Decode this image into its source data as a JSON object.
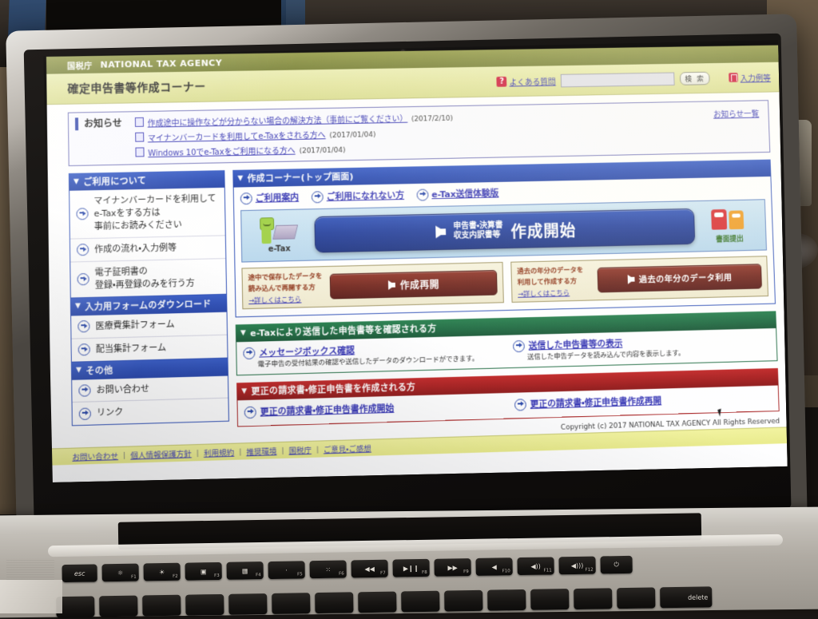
{
  "header": {
    "agency_jp": "国税庁",
    "agency_en": "NATIONAL TAX AGENCY",
    "site_title": "確定申告書等作成コーナー",
    "faq_badge": "?",
    "faq_label": "よくある質問",
    "search_value": "",
    "search_placeholder": "",
    "search_button": "検 索",
    "examples_label": "入力例等"
  },
  "notices": {
    "label": "お知らせ",
    "view_all": "お知らせ一覧",
    "items": [
      {
        "text": "作成途中に操作などが分からない場合の解決方法（事前にご覧ください）",
        "date": "(2017/2/10)"
      },
      {
        "text": "マイナンバーカードを利用してe-Taxをされる方へ",
        "date": "(2017/01/04)"
      },
      {
        "text": "Windows 10でe-Taxをご利用になる方へ",
        "date": "(2017/01/04)"
      }
    ]
  },
  "sidebar": {
    "sections": [
      {
        "title": "ご利用について",
        "items": [
          {
            "lines": [
              "マイナンバーカードを利用して",
              "e-Taxをする方は",
              "事前にお読みください"
            ]
          },
          {
            "lines": [
              "作成の流れ・入力例等"
            ]
          },
          {
            "lines": [
              "電子証明書の",
              "登録・再登録のみを行う方"
            ]
          }
        ]
      },
      {
        "title": "入力用フォームのダウンロード",
        "items": [
          {
            "lines": [
              "医療費集計フォーム"
            ]
          },
          {
            "lines": [
              "配当集計フォーム"
            ]
          }
        ]
      },
      {
        "title": "その他",
        "items": [
          {
            "lines": [
              "お問い合わせ"
            ]
          },
          {
            "lines": [
              "リンク"
            ]
          }
        ]
      }
    ]
  },
  "main": {
    "title": "作成コーナー(トップ画面)",
    "top_links": [
      "ご利用案内",
      "ご利用になれない方",
      "e-Tax送信体験版"
    ],
    "start_band": {
      "etax_label": "e-Tax",
      "button_sub_line1": "申告書・決算書",
      "button_sub_line2": "収支内訳書等",
      "button_main": "作成開始",
      "paper_label": "書面提出"
    },
    "resume_boxes": [
      {
        "desc_line1": "途中で保存したデータを",
        "desc_line2": "読み込んで再開する方",
        "more": "→詳しくはこちら",
        "button": "作成再開"
      },
      {
        "desc_line1": "過去の年分のデータを",
        "desc_line2": "利用して作成する方",
        "more": "→詳しくはこちら",
        "button": "過去の年分のデータ利用"
      }
    ]
  },
  "etax_section": {
    "title": "e-Taxにより送信した申告書等を確認される方",
    "links": [
      {
        "label": "メッセージボックス確認",
        "desc": "電子申告の受付結果の確認や送信したデータのダウンロードができます。"
      },
      {
        "label": "送信した申告書等の表示",
        "desc": "送信した申告データを読み込んで内容を表示します。"
      }
    ]
  },
  "amend_section": {
    "title": "更正の請求書・修正申告書を作成される方",
    "links": [
      {
        "label": "更正の請求書・修正申告書作成開始",
        "desc": ""
      },
      {
        "label": "更正の請求書・修正申告書作成再開",
        "desc": ""
      }
    ]
  },
  "footer": {
    "copyright": "Copyright (c) 2017 NATIONAL TAX AGENCY All Rights Reserved",
    "links": [
      "お問い合わせ",
      "個人情報保護方針",
      "利用規約",
      "推奨環境",
      "国税庁",
      "ご意見・ご感想"
    ],
    "separator": "|"
  },
  "hardware": {
    "keys_fn": [
      "esc",
      "F1",
      "F2",
      "F3",
      "F4",
      "F5",
      "F6",
      "F7",
      "F8",
      "F9",
      "F10",
      "F11",
      "F12",
      "power"
    ],
    "key_glyphs": [
      "esc",
      "☼",
      "☀",
      "▣",
      "▦",
      "·",
      "⁙",
      "◀◀",
      "▶❙❙",
      "▶▶",
      "◀",
      "◀))",
      "◀)))",
      "⏻"
    ],
    "key_delete": "delete"
  },
  "colors": {
    "header_green": "#7e8635",
    "header_cream": "#e2e49c",
    "panel_blue": "#2447b4",
    "panel_green": "#16653a",
    "panel_red": "#a41717",
    "link_blue": "#2b2bb0",
    "footer_yellow": "#e9eb86"
  }
}
